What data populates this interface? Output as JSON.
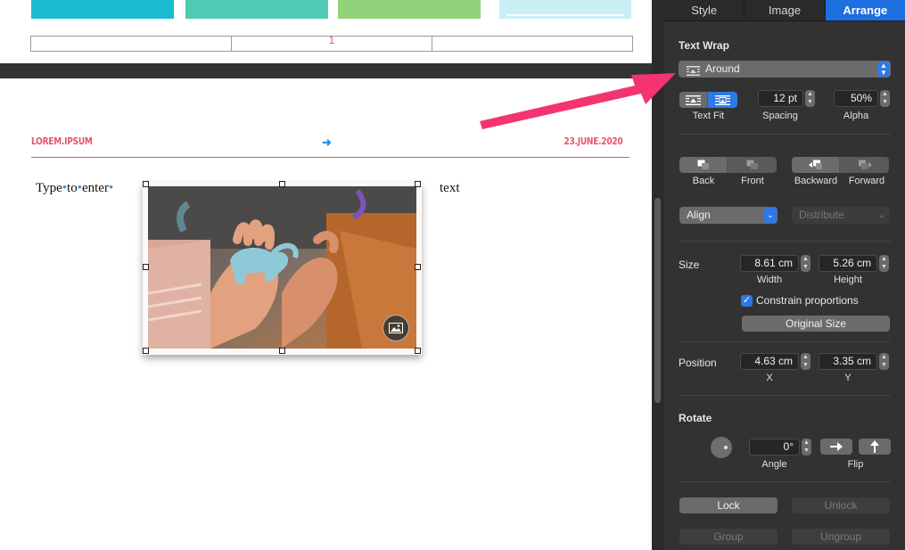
{
  "document": {
    "page_number": "1",
    "header_left": "LOREM.IPSUM",
    "header_arrow": "➜",
    "header_right": "23.JUNE.2020",
    "body_words": [
      "Type",
      "to",
      "enter"
    ],
    "body_dot": "•",
    "body_text_right": "text",
    "swatch_colors": [
      "#1bbcd1",
      "#4fcab3",
      "#92d27a",
      "#c9eef4"
    ],
    "accent_color": "#e8546a"
  },
  "inspector": {
    "tabs": [
      "Style",
      "Image",
      "Arrange"
    ],
    "active_tab": "Arrange",
    "text_wrap": {
      "section_label": "Text Wrap",
      "mode": "Around",
      "text_fit_label": "Text Fit",
      "spacing_value": "12 pt",
      "spacing_label": "Spacing",
      "alpha_value": "50%",
      "alpha_label": "Alpha"
    },
    "layering": {
      "back": "Back",
      "front": "Front",
      "backward": "Backward",
      "forward": "Forward"
    },
    "align_label": "Align",
    "distribute_label": "Distribute",
    "size": {
      "label": "Size",
      "width_value": "8.61 cm",
      "width_label": "Width",
      "height_value": "5.26 cm",
      "height_label": "Height",
      "constrain_label": "Constrain proportions",
      "constrain_checked": true,
      "original_size_label": "Original Size"
    },
    "position": {
      "label": "Position",
      "x_value": "4.63 cm",
      "x_label": "X",
      "y_value": "3.35 cm",
      "y_label": "Y"
    },
    "rotate": {
      "label": "Rotate",
      "angle_value": "0°",
      "angle_label": "Angle",
      "flip_label": "Flip"
    },
    "lock_label": "Lock",
    "unlock_label": "Unlock",
    "group_label": "Group",
    "ungroup_label": "Ungroup",
    "accent_color": "#2f79e6"
  },
  "annotation": {
    "arrow_color": "#f4346f"
  }
}
